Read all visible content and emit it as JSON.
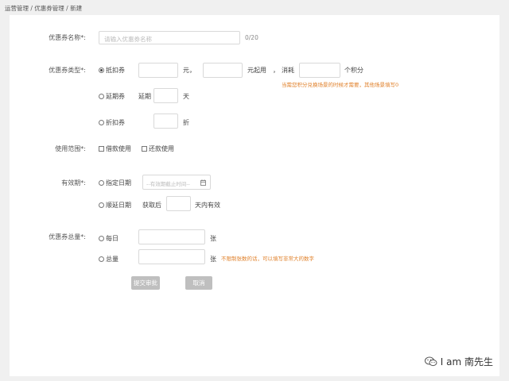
{
  "breadcrumb": "运营管理 / 优惠券管理 / 新建",
  "name_row": {
    "label": "优惠券名称*:",
    "placeholder": "请输入优惠券名称",
    "counter": "0/20"
  },
  "type_row": {
    "label": "优惠券类型*:",
    "options": {
      "deduct": "抵扣券",
      "extend": "延期券",
      "discount": "折扣券"
    },
    "unit_yuan": "元，",
    "unit_threshold": "元起用",
    "comma": "，",
    "consume": "消耗",
    "points_unit": "个积分",
    "points_hint": "当需您积分兑换场景的时候才需要，其他场景填写0",
    "extend_prefix": "延期",
    "day_unit": "天",
    "discount_unit": "折"
  },
  "scope_row": {
    "label": "使用范围*:",
    "borrow": "借款使用",
    "repay": "还款使用"
  },
  "validity_row": {
    "label": "有效期*:",
    "fixed_date": "指定日期",
    "date_placeholder": "--有效期截止时间--",
    "defer_date": "顺延日期",
    "after_get": "获取后",
    "days_valid": "天内有效"
  },
  "total_row": {
    "label": "优惠券总量*:",
    "daily": "每日",
    "total": "总量",
    "unit": "张",
    "hint": "不限制张数的话，可以填写非常大的数字"
  },
  "buttons": {
    "submit": "提交审批",
    "cancel": "取消"
  },
  "watermark": "I am 南先生"
}
